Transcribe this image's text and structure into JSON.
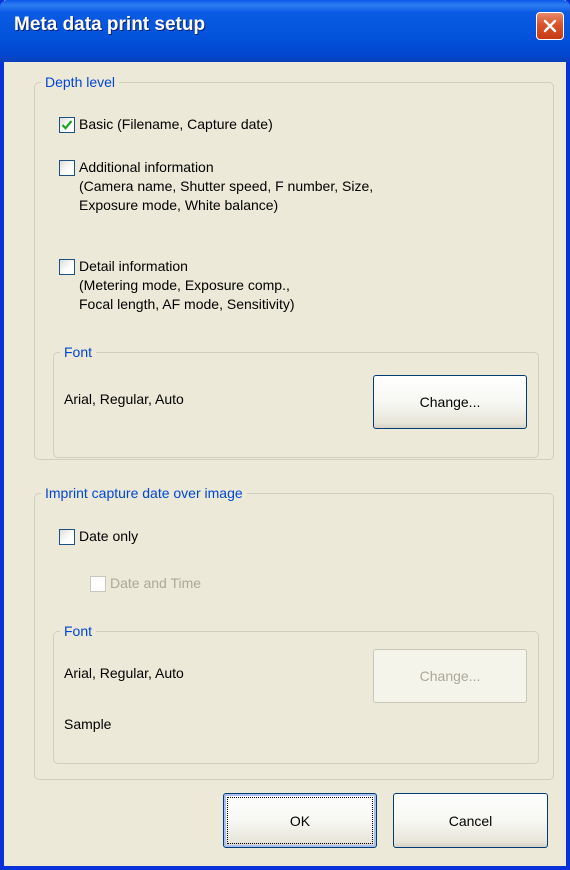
{
  "window": {
    "title": "Meta data print setup"
  },
  "depth_level": {
    "label": "Depth level",
    "options": [
      {
        "lines": [
          "Basic (Filename, Capture date)"
        ],
        "checked": true
      },
      {
        "lines": [
          "Additional information",
          "(Camera name, Shutter speed, F number, Size,",
          "Exposure mode, White balance)"
        ],
        "checked": false
      },
      {
        "lines": [
          "Detail information",
          "(Metering mode, Exposure comp.,",
          "Focal length, AF mode, Sensitivity)"
        ],
        "checked": false
      }
    ],
    "font": {
      "label": "Font",
      "value": "Arial, Regular, Auto",
      "button": "Change..."
    }
  },
  "imprint": {
    "label": "Imprint capture date over image",
    "date_only": {
      "label": "Date only",
      "checked": false
    },
    "date_time": {
      "label": "Date and Time",
      "checked": false,
      "enabled": false
    },
    "font": {
      "label": "Font",
      "value": "Arial, Regular, Auto",
      "button": "Change...",
      "sample": "Sample"
    }
  },
  "buttons": {
    "ok": "OK",
    "cancel": "Cancel"
  },
  "colors": {
    "group_label": "#0046d5",
    "check": "#21a121",
    "titlebar": "#0352db"
  }
}
